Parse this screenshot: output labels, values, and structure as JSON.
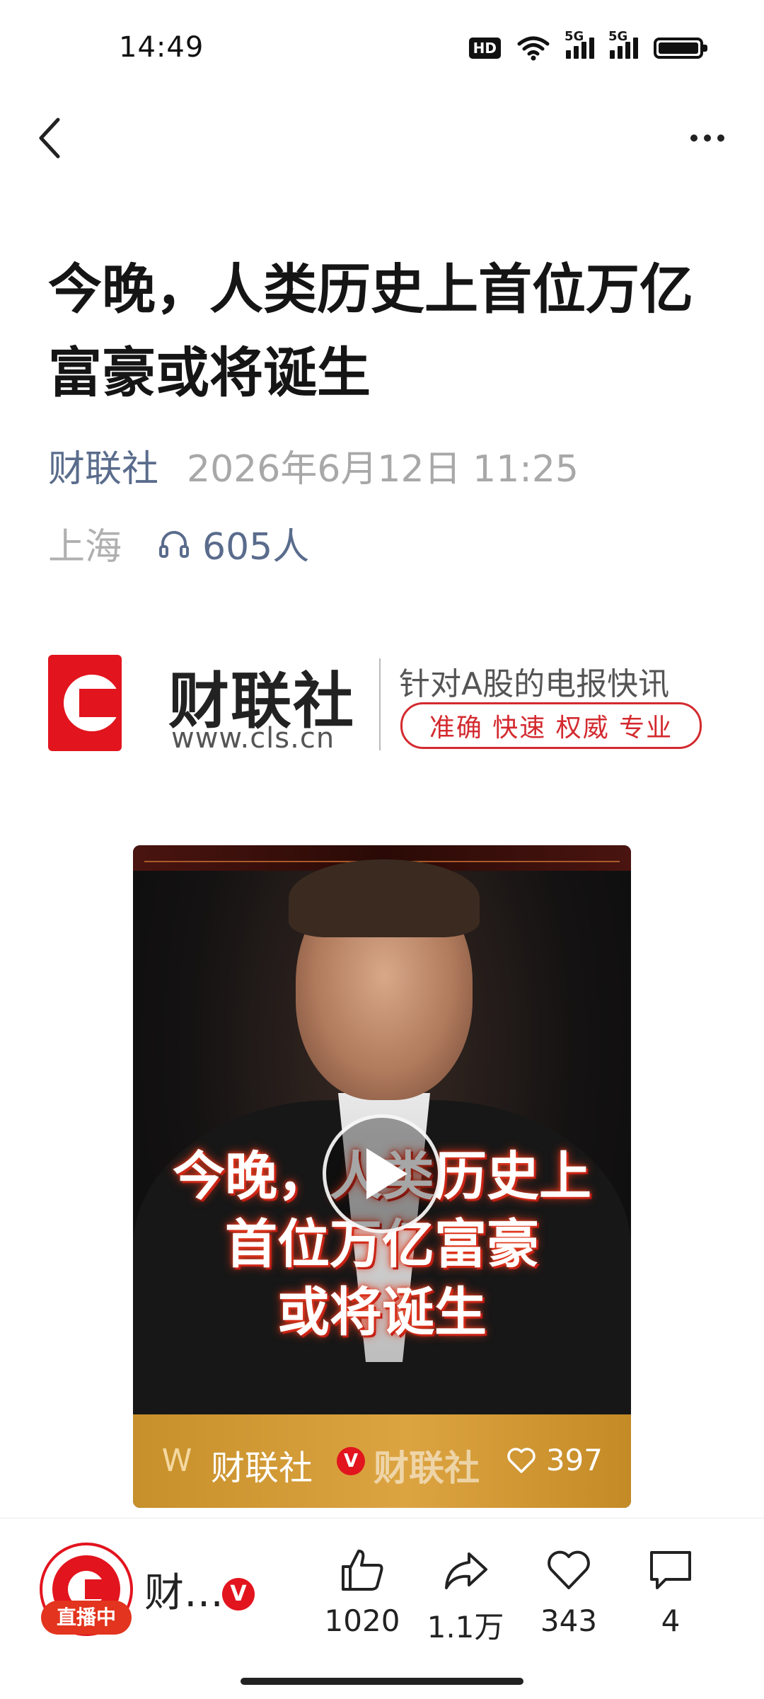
{
  "status_bar": {
    "time": "14:49",
    "hd_badge": "HD",
    "network1": "5G",
    "network2": "5G"
  },
  "article": {
    "title": "今晚，人类历史上首位万亿富豪或将诞生",
    "source": "财联社",
    "date": "2026年6月12日 11:25",
    "location": "上海",
    "listen_count": "605人"
  },
  "banner": {
    "brand": "财联社",
    "url": "www.cls.cn",
    "slogan": "针对A股的电报快讯",
    "tagline": "准确 快速 权威 专业"
  },
  "video": {
    "overlay_line1": "今晚，人类历史上",
    "overlay_line2": "首位万亿富豪",
    "overlay_line3": "或将诞生",
    "channel": "财联社",
    "verified": "V",
    "watermark": "财联社",
    "likes": "397"
  },
  "bottom_bar": {
    "author_name": "财…",
    "verified": "V",
    "live_badge": "直播中",
    "like_count": "1020",
    "share_count": "1.1万",
    "favorite_count": "343",
    "comment_count": "4"
  }
}
